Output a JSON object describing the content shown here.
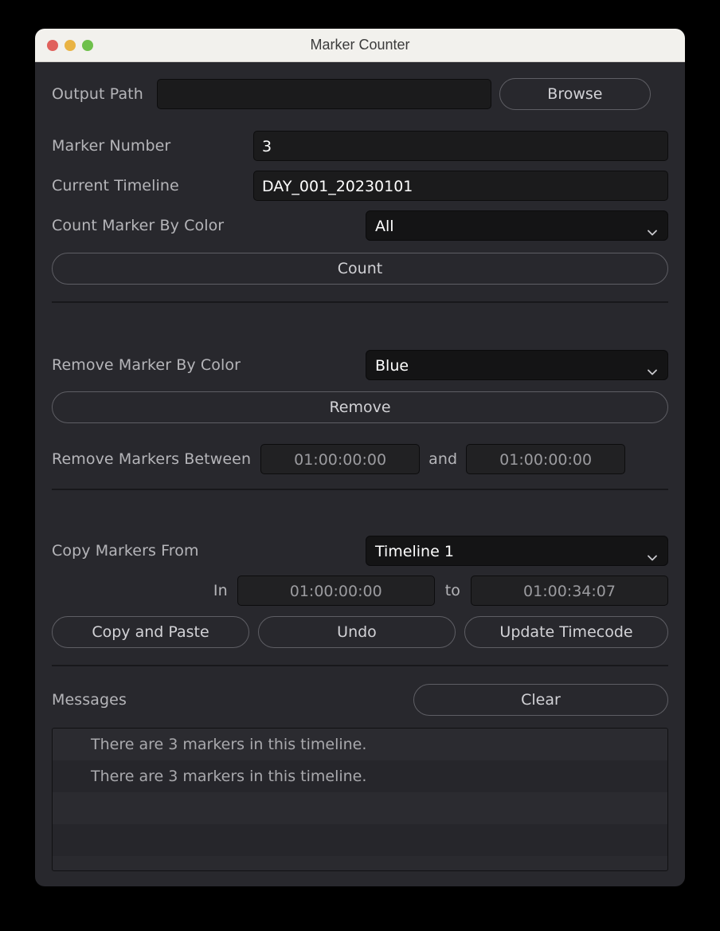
{
  "window": {
    "title": "Marker Counter",
    "controls": {
      "close": "close-button",
      "minimize": "minimize-button",
      "maximize": "maximize-button"
    }
  },
  "output_path": {
    "label": "Output Path",
    "value": "",
    "placeholder": "",
    "browse_label": "Browse"
  },
  "marker_number": {
    "label": "Marker Number",
    "value": "3"
  },
  "current_timeline": {
    "label": "Current Timeline",
    "value": "DAY_001_20230101"
  },
  "count_section": {
    "color_label": "Count Marker By Color",
    "color_value": "All",
    "count_label": "Count"
  },
  "remove_section": {
    "color_label": "Remove Marker By Color",
    "color_value": "Blue",
    "remove_label": "Remove",
    "between_label": "Remove Markers Between",
    "from_value": "01:00:00:00",
    "and_label": "and",
    "to_value": "01:00:00:00"
  },
  "copy_section": {
    "from_label": "Copy Markers From",
    "from_value": "Timeline 1",
    "in_label": "In",
    "in_value": "01:00:00:00",
    "to_label": "to",
    "to_value": "01:00:34:07",
    "copy_paste_label": "Copy and Paste",
    "undo_label": "Undo",
    "update_timecode_label": "Update Timecode"
  },
  "messages": {
    "label": "Messages",
    "clear_label": "Clear",
    "items": [
      "There are 3 markers in this timeline.",
      "There are 3 markers in this timeline.",
      "",
      ""
    ]
  },
  "colors": {
    "window_bg": "#28282d",
    "titlebar_bg": "#f2f1ed",
    "field_bg": "#1b1b1c",
    "label_text": "#b5b5b9",
    "value_text": "#ffffff",
    "placeholder_text": "#9b9b9f",
    "button_border": "#5e5e64",
    "divider": "#18181b",
    "traffic_close": "#e0615c",
    "traffic_min": "#e9b343",
    "traffic_max": "#6ec04b"
  }
}
